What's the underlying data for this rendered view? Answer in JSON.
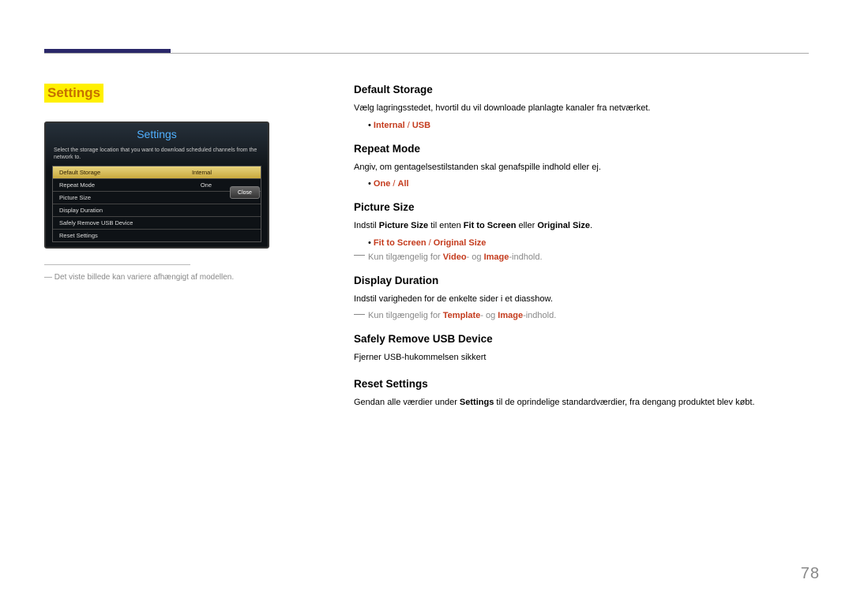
{
  "page_number": "78",
  "left": {
    "title": "Settings",
    "screenshot": {
      "title": "Settings",
      "description": "Select the storage location that you want to download scheduled channels from the network to.",
      "rows": [
        {
          "label": "Default Storage",
          "value": "Internal",
          "selected": true
        },
        {
          "label": "Repeat Mode",
          "value": "One"
        },
        {
          "label": "Picture Size",
          "value": ""
        },
        {
          "label": "Display Duration",
          "value": ""
        },
        {
          "label": "Safely Remove USB Device",
          "value": ""
        },
        {
          "label": "Reset Settings",
          "value": ""
        }
      ],
      "close": "Close"
    },
    "note": "Det viste billede kan variere afhængigt af modellen."
  },
  "right": {
    "default_storage": {
      "h": "Default Storage",
      "p": "Vælg lagringsstedet, hvortil du vil downloade planlagte kanaler fra netværket.",
      "opt_a": "Internal",
      "opt_b": "USB"
    },
    "repeat_mode": {
      "h": "Repeat Mode",
      "p": "Angiv, om gentagelsestilstanden skal genafspille indhold eller ej.",
      "opt_a": "One",
      "opt_b": "All"
    },
    "picture_size": {
      "h": "Picture Size",
      "p_pre": "Indstil ",
      "p_bold1": "Picture Size",
      "p_mid": " til enten ",
      "p_bold2": "Fit to Screen",
      "p_mid2": " eller ",
      "p_bold3": "Original Size",
      "p_end": ".",
      "opt_a": "Fit to Screen",
      "opt_b": "Original Size",
      "note_pre": "Kun tilgængelig for ",
      "note_b1": "Video",
      "note_mid": "- og ",
      "note_b2": "Image",
      "note_end": "-indhold."
    },
    "display_duration": {
      "h": "Display Duration",
      "p": "Indstil varigheden for de enkelte sider i et diasshow.",
      "note_pre": "Kun tilgængelig for ",
      "note_b1": "Template",
      "note_mid": "- og ",
      "note_b2": "Image",
      "note_end": "-indhold."
    },
    "safely_remove": {
      "h": "Safely Remove USB Device",
      "p": "Fjerner USB-hukommelsen sikkert"
    },
    "reset_settings": {
      "h": "Reset Settings",
      "p_pre": "Gendan alle værdier under ",
      "p_bold": "Settings",
      "p_end": " til de oprindelige standardværdier, fra dengang produktet blev købt."
    }
  }
}
